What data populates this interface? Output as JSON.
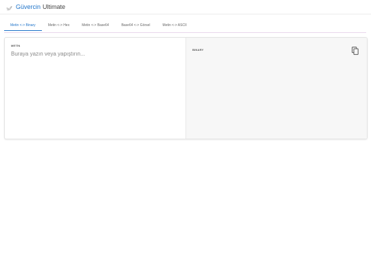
{
  "app": {
    "brand_primary": "Güvercin",
    "brand_secondary": "Ultimate",
    "accent_color": "#1e73c9",
    "logo_icon": "dove-icon"
  },
  "tabs": [
    {
      "label": "Metin <-> Binary",
      "active": true
    },
    {
      "label": "Metin <-> Hex",
      "active": false
    },
    {
      "label": "Metin <-> Base64",
      "active": false
    },
    {
      "label": "Base64 <-> Görsel",
      "active": false
    },
    {
      "label": "Metin <-> ASCII",
      "active": false
    }
  ],
  "input_pane": {
    "label": "METİN",
    "value": "",
    "placeholder": "Buraya yazın veya yapıştırın..."
  },
  "output_pane": {
    "label": "BINARY",
    "value": "",
    "copy_icon": "copy-icon"
  }
}
